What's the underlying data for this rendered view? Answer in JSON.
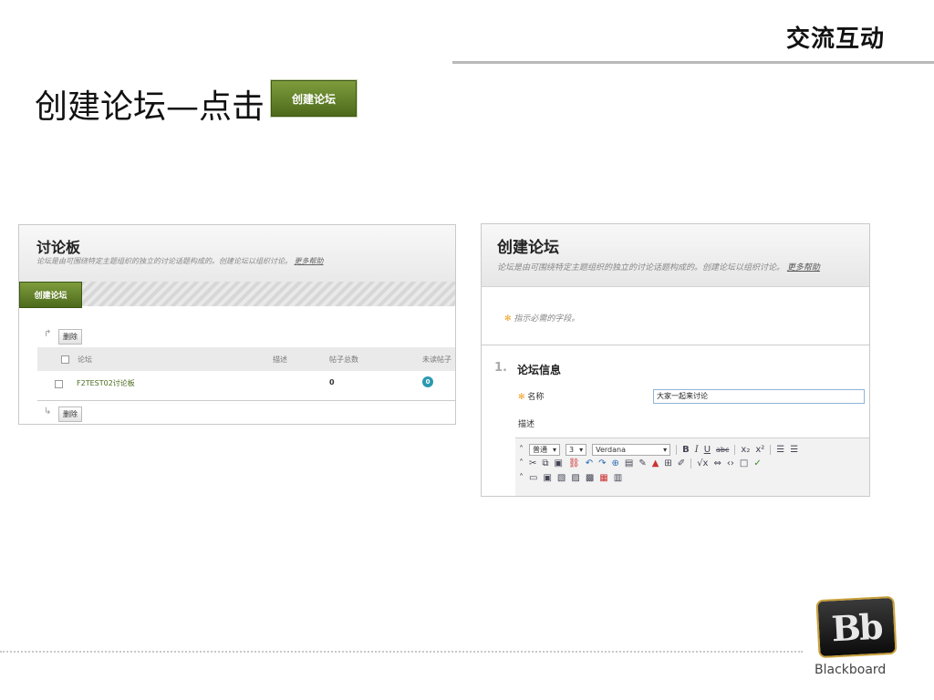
{
  "header": {
    "section_title": "交流互动"
  },
  "slide": {
    "heading": "创建论坛—点击",
    "button_label": "创建论坛"
  },
  "discussion_board": {
    "title": "讨论板",
    "description": "论坛是由可围绕特定主题组织的独立的讨论话题构成的。创建论坛以组织讨论。",
    "help_link": "更多帮助",
    "create_button": "创建论坛",
    "delete_button_top": "删除",
    "delete_button_bottom": "删除",
    "columns": [
      "论坛",
      "描述",
      "帖子总数",
      "未读帖子"
    ],
    "rows": [
      {
        "forum": "F2TEST02讨论板",
        "description": "",
        "total_posts": "0",
        "unread_posts": "0"
      }
    ]
  },
  "create_forum": {
    "title": "创建论坛",
    "description": "论坛是由可围绕特定主题组织的独立的讨论话题构成的。创建论坛以组织讨论。",
    "help_link": "更多帮助",
    "required_note": "指示必需的字段。",
    "section_number": "1.",
    "section_title": "论坛信息",
    "name_label": "名称",
    "name_value": "大家一起来讨论",
    "description_label": "描述",
    "editor": {
      "format": "普通",
      "size": "3",
      "font": "Verdana"
    }
  },
  "footer": {
    "brand_text": "Blackboard",
    "logo_letters": "Bb"
  }
}
